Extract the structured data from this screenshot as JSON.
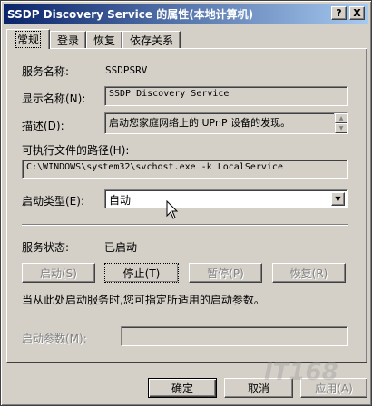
{
  "window": {
    "title": "SSDP Discovery Service 的属性(本地计算机)",
    "help_btn": "?",
    "close_btn": "X"
  },
  "tabs": [
    {
      "label": "常规",
      "active": true
    },
    {
      "label": "登录"
    },
    {
      "label": "恢复"
    },
    {
      "label": "依存关系"
    }
  ],
  "general": {
    "service_name_label": "服务名称:",
    "service_name_value": "SSDPSRV",
    "display_name_label": "显示名称(N):",
    "display_name_value": "SSDP Discovery Service",
    "description_label": "描述(D):",
    "description_value": "启动您家庭网络上的 UPnP 设备的发现。",
    "exe_path_label": "可执行文件的路径(H):",
    "exe_path_value": "C:\\WINDOWS\\system32\\svchost.exe -k LocalService",
    "startup_type_label": "启动类型(E):",
    "startup_type_value": "自动",
    "status_label": "服务状态:",
    "status_value": "已启动",
    "start_btn": "启动(S)",
    "stop_btn": "停止(T)",
    "pause_btn": "暂停(P)",
    "resume_btn": "恢复(R)",
    "hint_text": "当从此处启动服务时,您可指定所适用的启动参数。",
    "params_label": "启动参数(M):",
    "params_value": ""
  },
  "footer": {
    "ok_btn": "确定",
    "cancel_btn": "取消",
    "apply_btn": "应用(A)"
  },
  "watermark": "IT168"
}
